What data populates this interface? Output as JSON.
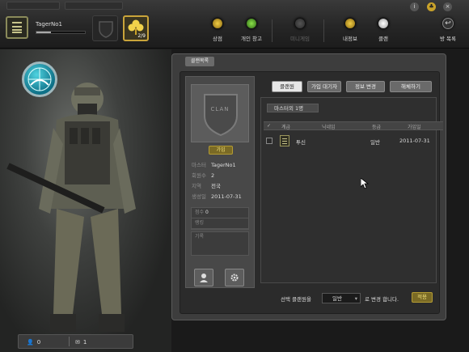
{
  "header": {
    "player_name": "TagerNo1",
    "clover_count": "2/9",
    "exp_progress": 0.3,
    "nav": [
      {
        "label": "상점",
        "color": "#c9a22a",
        "enabled": true
      },
      {
        "label": "개인 창고",
        "color": "#5aa83a",
        "enabled": true
      },
      {
        "label": "미니게임",
        "color": "#555555",
        "enabled": false
      },
      {
        "label": "내정보",
        "color": "#c9a22a",
        "enabled": true
      },
      {
        "label": "클랜",
        "color": "#eeeeee",
        "enabled": true
      },
      {
        "label": "방 목록",
        "icon": "return-icon",
        "enabled": true
      }
    ],
    "system_icons": [
      "info-icon",
      "clover-icon",
      "close-icon"
    ]
  },
  "panel": {
    "back_label": "클랜목록",
    "emblem_text": "CLAN",
    "clan_button": "가입",
    "info": [
      {
        "key": "마스터",
        "value": "TagerNo1"
      },
      {
        "key": "회원수",
        "value": "2"
      },
      {
        "key": "지역",
        "value": "전국"
      },
      {
        "key": "생성일",
        "value": "2011-07-31"
      }
    ],
    "stats": [
      {
        "key": "점수",
        "value": "0"
      },
      {
        "key": "랭킹",
        "value": ""
      }
    ],
    "stats_note": "기록",
    "tabs": [
      "클랜원",
      "가입 대기자",
      "정보 변경",
      "해체하기"
    ],
    "active_tab": 0,
    "member_count": "마스터외 1명",
    "columns": [
      "계급",
      "닉네임",
      "등급",
      "가입일"
    ],
    "members": [
      {
        "nickname": "투신",
        "grade": "일반",
        "joined": "2011-07-31"
      }
    ],
    "footer": {
      "prefix": "선택 클랜원을",
      "grade_value": "일반",
      "suffix": "로 변경 합니다.",
      "apply": "적용"
    }
  },
  "bottom_bar": {
    "friends": "0",
    "mail": "1"
  }
}
